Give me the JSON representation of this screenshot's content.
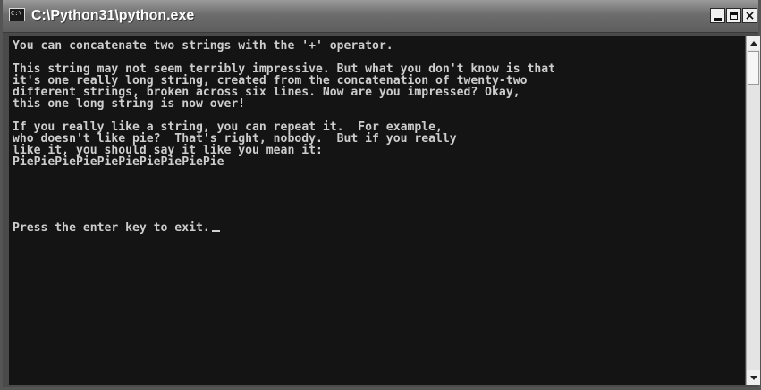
{
  "window": {
    "title": "C:\\Python31\\python.exe",
    "icon_text": "C:\\"
  },
  "controls": {
    "minimize": "minimize",
    "maximize": "maximize",
    "close": "×"
  },
  "console": {
    "lines": [
      "You can concatenate two strings with the '+' operator.",
      "",
      "This string may not seem terribly impressive. But what you don't know is that",
      "it's one really long string, created from the concatenation of twenty-two",
      "different strings, broken across six lines. Now are you impressed? Okay,",
      "this one long string is now over!",
      "",
      "If you really like a string, you can repeat it.  For example,",
      "who doesn't like pie?  That's right, nobody.  But if you really",
      "like it, you should say it like you mean it:",
      "PiePiePiePiePiePiePiePiePiePie",
      "",
      "",
      "Press the enter key to exit."
    ]
  },
  "colors": {
    "console_bg": "#141414",
    "console_fg": "#cdcdcd",
    "titlebar": "#6d6d6d"
  },
  "icons": {
    "app": "console-app-icon",
    "minimize": "minimize-icon",
    "maximize": "maximize-icon",
    "close": "close-icon",
    "scroll_up": "arrow-up-icon",
    "scroll_down": "arrow-down-icon"
  }
}
